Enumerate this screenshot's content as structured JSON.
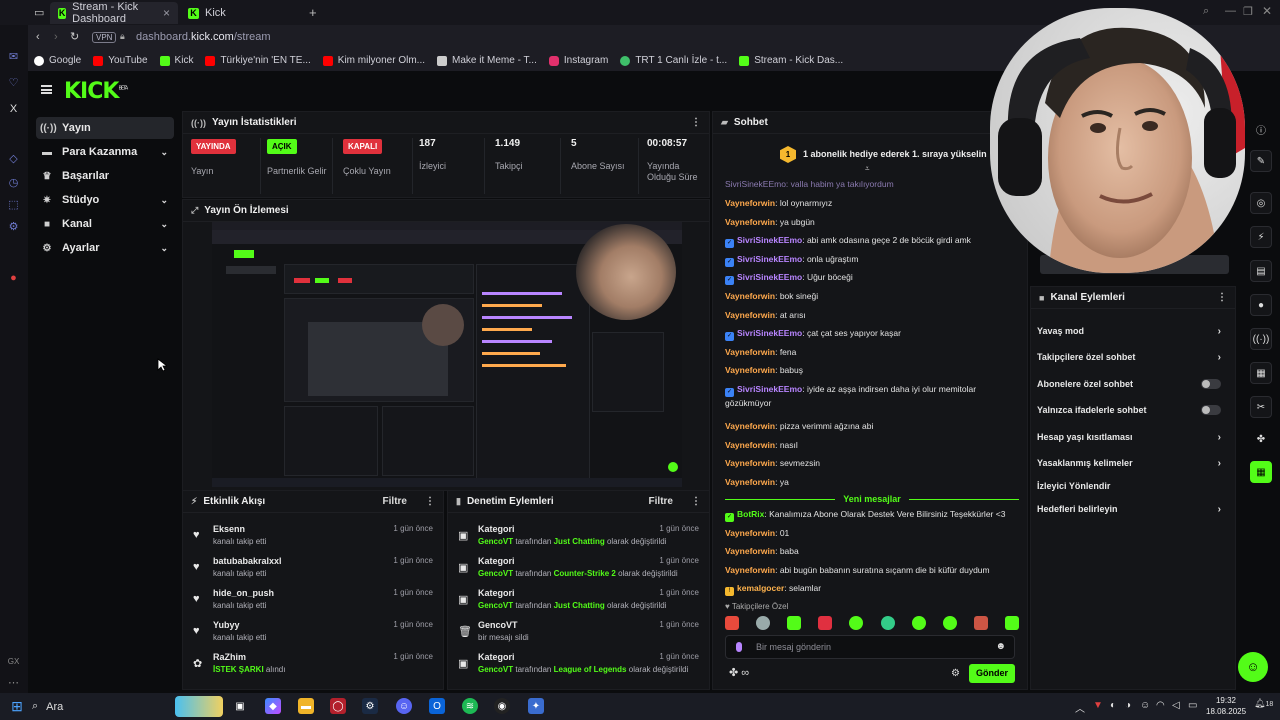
{
  "browser": {
    "tabs": [
      {
        "title": "Stream - Kick Dashboard",
        "active": true
      },
      {
        "title": "Kick",
        "active": false
      }
    ],
    "vpn": "VPN",
    "url_prefix": "dashboard.",
    "url_domain": "kick.com",
    "url_path": "/stream",
    "bookmarks": [
      "Google",
      "YouTube",
      "Kick",
      "Türkiye'nin 'EN TE...",
      "Kim milyoner Olm...",
      "Make it Meme - T...",
      "Instagram",
      "TRT 1 Canlı İzle - t...",
      "Stream - Kick Das..."
    ]
  },
  "kick": {
    "logo": "KICK",
    "beta": "BETA"
  },
  "nav": {
    "items": [
      {
        "label": "Yayın",
        "selected": true,
        "has_chevron": false
      },
      {
        "label": "Para Kazanma",
        "selected": false,
        "has_chevron": true
      },
      {
        "label": "Başarılar",
        "selected": false,
        "has_chevron": false
      },
      {
        "label": "Stüdyo",
        "selected": false,
        "has_chevron": true
      },
      {
        "label": "Kanal",
        "selected": false,
        "has_chevron": true
      },
      {
        "label": "Ayarlar",
        "selected": false,
        "has_chevron": true
      }
    ]
  },
  "stats": {
    "title": "Yayın İstatistikleri",
    "items": [
      {
        "badge": "YAYINDA",
        "badge_color": "#e0313c",
        "label": "Yayın"
      },
      {
        "badge": "AÇIK",
        "badge_color": "#53fc18",
        "label": "Partnerlik Gelir"
      },
      {
        "badge": "KAPALI",
        "badge_color": "#e0313c",
        "label": "Çoklu Yayın"
      },
      {
        "value": "187",
        "label": "İzleyici"
      },
      {
        "value": "1.149",
        "label": "Takipçi"
      },
      {
        "value": "5",
        "label": "Abone Sayısı"
      },
      {
        "value": "00:08:57",
        "label": "Yayında Olduğu Süre"
      }
    ]
  },
  "preview": {
    "title": "Yayın Ön İzlemesi"
  },
  "activity": {
    "title": "Etkinlik Akışı",
    "filter": "Filtre",
    "items": [
      {
        "name": "Eksenn",
        "desc": "kanalı takip etti",
        "time": "1 gün önce"
      },
      {
        "name": "batubabakralxxl",
        "desc": "kanalı takip etti",
        "time": "1 gün önce"
      },
      {
        "name": "hide_on_push",
        "desc": "kanalı takip etti",
        "time": "1 gün önce"
      },
      {
        "name": "Yubyy",
        "desc": "kanalı takip etti",
        "time": "1 gün önce"
      },
      {
        "name": "RaZhim",
        "desc_green": "İSTEK ŞARKI",
        "desc": " alındı",
        "time": "1 gün önce"
      }
    ]
  },
  "moderation": {
    "title": "Denetim Eylemleri",
    "filter": "Filtre",
    "items": [
      {
        "title": "Kategori",
        "actor": "GencoVT",
        "mid": " tarafından ",
        "target": "Just Chatting",
        "end": " olarak değiştirildi",
        "time": "1 gün önce"
      },
      {
        "title": "Kategori",
        "actor": "GencoVT",
        "mid": " tarafından ",
        "target": "Counter-Strike 2",
        "end": " olarak değiştirildi",
        "time": "1 gün önce"
      },
      {
        "title": "Kategori",
        "actor": "GencoVT",
        "mid": " tarafından ",
        "target": "Just Chatting",
        "end": " olarak değiştirildi",
        "time": "1 gün önce"
      },
      {
        "title": "GencoVT",
        "plain": "bir mesajı sildi",
        "time": "1 gün önce"
      },
      {
        "title": "Kategori",
        "actor": "GencoVT",
        "mid": " tarafından ",
        "target": "League of Legends",
        "end": " olarak değiştirildi",
        "time": "1 gün önce"
      }
    ]
  },
  "chat": {
    "title": "Sohbet",
    "pinned": "1 abonelik hediye ederek 1. sıraya yükselin",
    "pinned_number": "1",
    "partial": "SivriSinekEEmo: valla habim ya takılıyordum",
    "messages": [
      {
        "user": "Vayneforwin",
        "color": "o",
        "text": "lol oynarmıyız"
      },
      {
        "user": "Vayneforwin",
        "color": "o",
        "text": "ya ubgün"
      },
      {
        "user": "SivriSinekEEmo",
        "color": "p",
        "badge": true,
        "text": "abi amk odasına geçe 2 de böcük girdi amk"
      },
      {
        "user": "SivriSinekEEmo",
        "color": "p",
        "badge": true,
        "text": "onla uğraştım"
      },
      {
        "user": "SivriSinekEEmo",
        "color": "p",
        "badge": true,
        "text": "Uğur böceği"
      },
      {
        "user": "Vayneforwin",
        "color": "o",
        "text": "bok sineği"
      },
      {
        "user": "Vayneforwin",
        "color": "o",
        "text": "at arısı"
      },
      {
        "user": "SivriSinekEEmo",
        "color": "p",
        "badge": true,
        "text": "çat çat ses yapıyor kaşar"
      },
      {
        "user": "Vayneforwin",
        "color": "o",
        "text": "fena"
      },
      {
        "user": "Vayneforwin",
        "color": "o",
        "text": "babuş"
      },
      {
        "user": "SivriSinekEEmo",
        "color": "p",
        "badge": true,
        "text": "iyide az aşşa indirsen daha iyi olur memitolar gözükmüyor"
      },
      {
        "user": "Vayneforwin",
        "color": "o",
        "text": "pizza verimmi ağzına abi"
      },
      {
        "user": "Vayneforwin",
        "color": "o",
        "text": "nasıl"
      },
      {
        "user": "Vayneforwin",
        "color": "o",
        "text": "sevmezsin"
      },
      {
        "user": "Vayneforwin",
        "color": "o",
        "text": "ya"
      }
    ],
    "new_messages": "Yeni mesajlar",
    "new": [
      {
        "user": "BotRix",
        "color": "g",
        "badge": true,
        "text": "Kanalımıza Abone Olarak Destek Vere Bilirsiniz Teşekkürler <3"
      },
      {
        "user": "Vayneforwin",
        "color": "o",
        "text": "01"
      },
      {
        "user": "Vayneforwin",
        "color": "o",
        "text": "baba"
      },
      {
        "user": "Vayneforwin",
        "color": "o",
        "text": "abi bugün babanın suratına sıçanm die bi küfür duydum"
      },
      {
        "user": "kemalgocer",
        "color": "y",
        "badge": true,
        "text": "selamlar"
      }
    ],
    "followers_only": "Takipçilere Özel",
    "input_placeholder": "Bir mesaj gönderin",
    "send": "Gönder",
    "infinity": "∞"
  },
  "channel_actions": {
    "title": "Kanal Eylemleri",
    "items": [
      {
        "label": "Yavaş mod",
        "kind": "chevron"
      },
      {
        "label": "Takipçilere özel sohbet",
        "kind": "chevron"
      },
      {
        "label": "Abonelere özel sohbet",
        "kind": "toggle"
      },
      {
        "label": "Yalnızca ifadelerle sohbet",
        "kind": "toggle"
      },
      {
        "label": "Hesap yaşı kısıtlaması",
        "kind": "chevron"
      },
      {
        "label": "Yasaklanmış kelimeler",
        "kind": "chevron"
      },
      {
        "label": "İzleyici Yönlendir",
        "kind": "none"
      },
      {
        "label": "Hedefleri belirleyin",
        "kind": "chevron"
      }
    ]
  },
  "taskbar": {
    "search": "Ara",
    "time": "19:32",
    "date": "18.08.2025",
    "notif": "18"
  },
  "colors": {
    "accent": "#53fc18",
    "live": "#e0313c",
    "bg": "#0b0c0e",
    "panel": "#141518"
  }
}
